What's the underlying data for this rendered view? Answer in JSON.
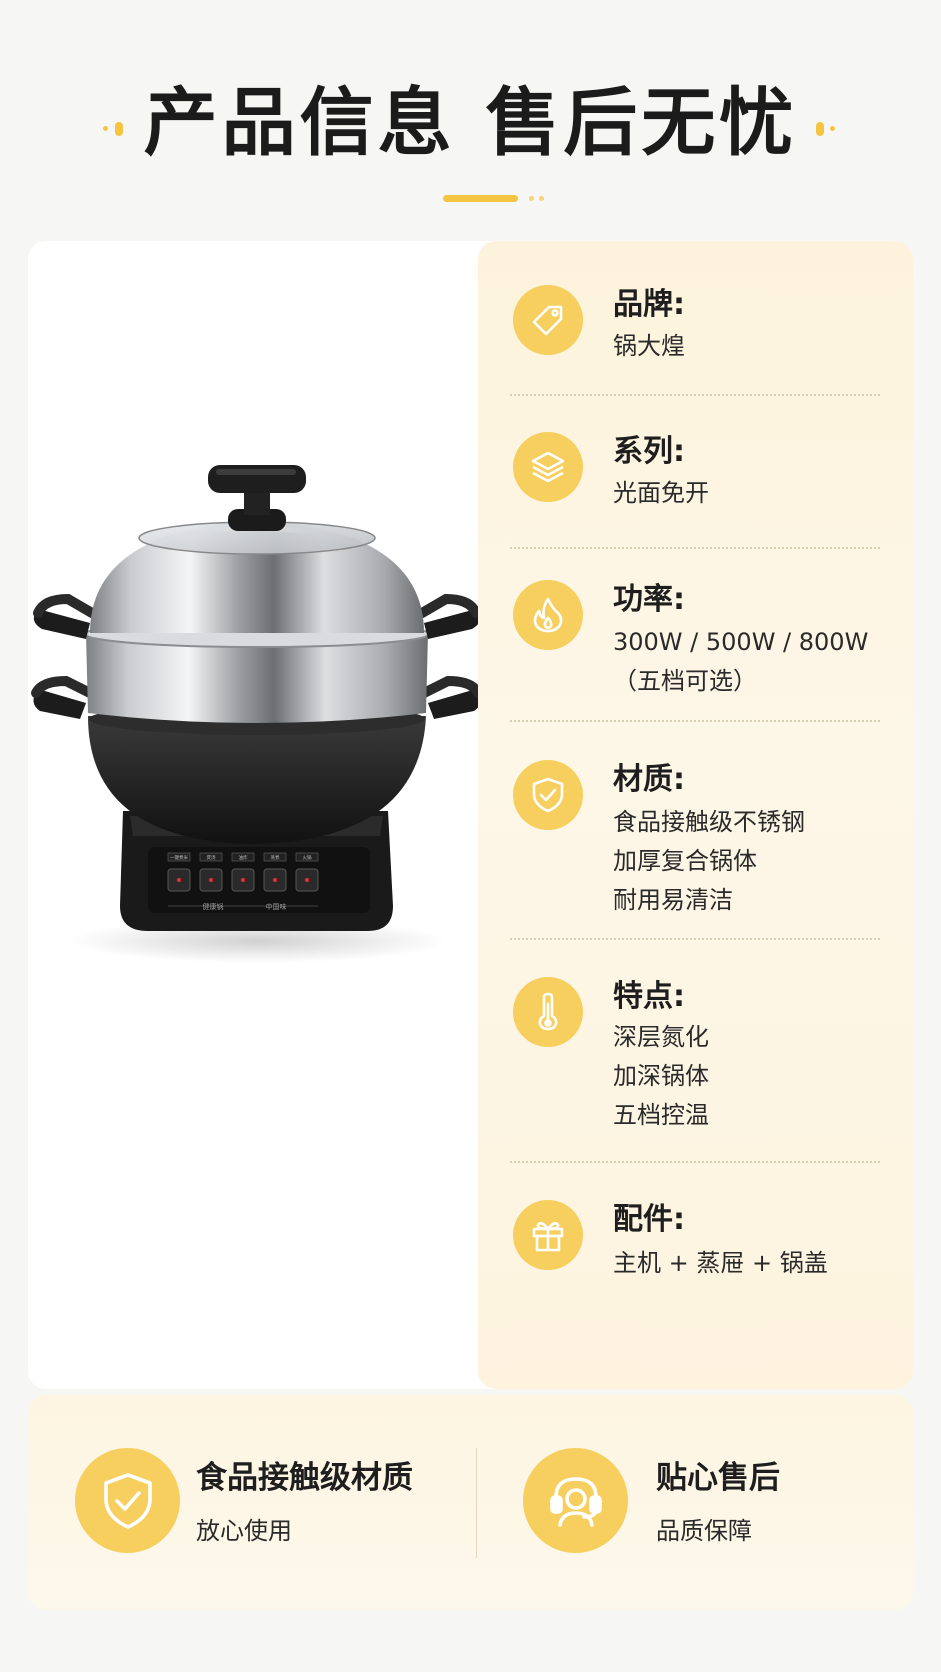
{
  "header": {
    "title": "产品信息 售后无忧"
  },
  "specs": [
    {
      "label": "品牌:",
      "lines": [
        "锅大煌"
      ],
      "icon": "tag-icon"
    },
    {
      "label": "系列:",
      "lines": [
        "光面免开"
      ],
      "icon": "layers-icon"
    },
    {
      "label": "功率:",
      "lines": [
        "300W / 500W / 800W",
        "（五档可选）"
      ],
      "icon": "flame-icon"
    },
    {
      "label": "材质:",
      "lines": [
        "食品接触级不锈钢",
        "加厚复合锅体",
        "耐用易清洁"
      ],
      "icon": "shield-check-icon"
    },
    {
      "label": "特点:",
      "lines": [
        "深层氮化",
        "加深锅体",
        "五档控温"
      ],
      "icon": "thermometer-icon"
    },
    {
      "label": "配件:",
      "lines": [
        "主机 + 蒸屉 + 锅盖"
      ],
      "icon": "gift-icon"
    }
  ],
  "product": {
    "panel_labels": [
      "一键煮米",
      "煲汤",
      "油炸",
      "蒸煮",
      "火锅"
    ],
    "base_labels": [
      "健康锅",
      "中国味"
    ]
  },
  "bottom": {
    "left": {
      "title": "食品接触级材质",
      "subtitle": "放心使用",
      "icon": "shield-check-icon"
    },
    "right": {
      "title": "贴心售后",
      "subtitle": "品质保障",
      "icon": "headset-support-icon"
    }
  },
  "colors": {
    "accent": "#f6cf5f",
    "spec_background": "#fdf5e1",
    "page_background": "#f6f6f4"
  }
}
